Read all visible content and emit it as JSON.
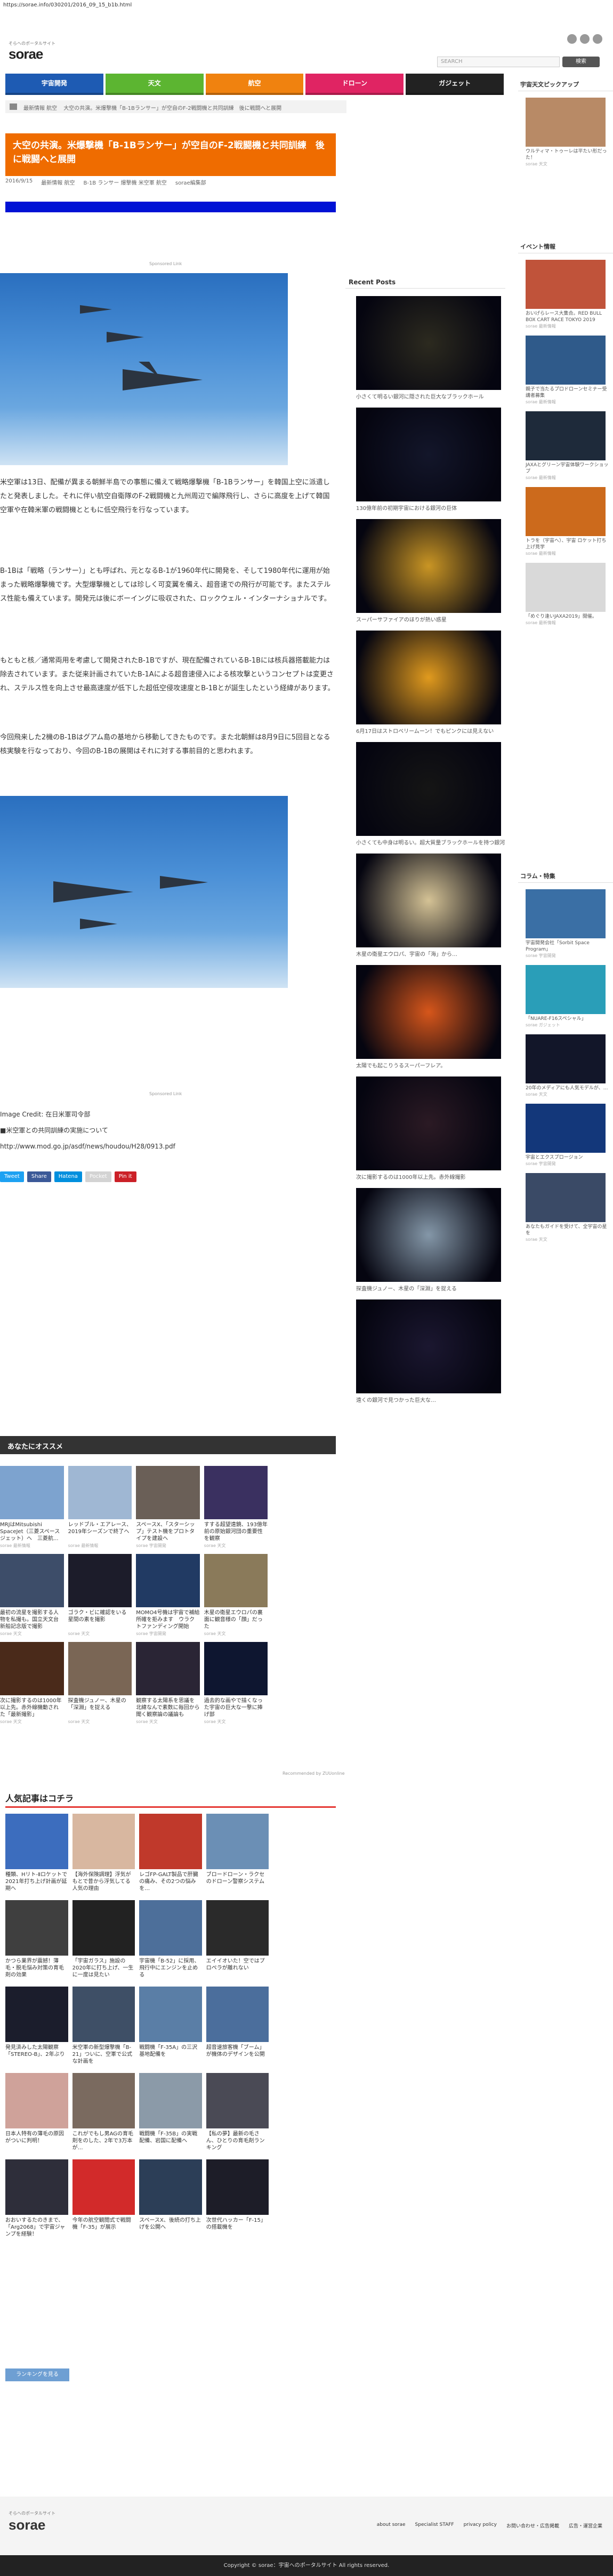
{
  "url": "https://sorae.info/030201/2016_09_15_b1b.html",
  "site": {
    "tagline": "そらへのポータルサイト",
    "logo": "sorae"
  },
  "search": {
    "placeholder": "SEARCH",
    "button": "検索"
  },
  "nav": [
    {
      "label": "宇宙開発",
      "color": "#1e5bb3"
    },
    {
      "label": "天文",
      "color": "#5cb531"
    },
    {
      "label": "航空",
      "color": "#f0820f"
    },
    {
      "label": "ドローン",
      "color": "#e02463"
    },
    {
      "label": "ガジェット",
      "color": "#222222"
    }
  ],
  "breadcrumb": [
    "ホーム",
    "最新情報 航空",
    "大空の共演。米爆撃機「B-1Bランサー」が空自のF-2戦闘機と共同訓練　後に戦闘へと展開"
  ],
  "article": {
    "title": "大空の共演。米爆撃機「B-1Bランサー」が空自のF-2戦闘機と共同訓練　後に戦闘へと展開",
    "date": "2016/9/15",
    "category": "最新情報 航空",
    "tags": "B-1B ランサー 爆撃機 米空軍 航空",
    "author": "sorae編集部",
    "sponsor": "Sponsored Link",
    "para1": "米空軍は13日、配備が異まる朝鮮半島での事態に備えて戦略爆撃機「B-1Bランサー」を韓国上空に派遣したと発表しました。それに伴い航空自衛隊のF-2戦闘機と九州周辺で編隊飛行し、さらに高度を上げて韓国空軍や在韓米軍の戦闘機とともに低空飛行を行なっています。",
    "para2": "B-1Bは「戦略（ランサー）」とも呼ばれ、元となるB-1が1960年代に開発を、そして1980年代に運用が始まった戦略爆撃機です。大型爆撃機としては珍しく可変翼を備え、超音速での飛行が可能です。またステルス性能も備えています。開発元は後にボーイングに吸収された、ロックウェル・インターナショナルです。",
    "para3": "もともと核／通常両用を考慮して開発されたB-1Bですが、現在配備されているB-1Bには核兵器搭載能力は除去されています。また従来計画されていたB-1Aによる超音速侵入による核攻撃というコンセプトは変更され、ステルス性を向上させ最高速度が低下した超低空侵攻速度とB-1Bとが誕生したという経緯があります。",
    "para4": "今回飛来した2機のB-1Bはグアム島の基地から移動してきたものです。また北朝鮮は8月9日に5回目となる核実験を行なっており、今回のB-1Bの展開はそれに対する事前目的と思われます。",
    "credit": "Image Credit: 在日米軍司令部",
    "credit2": "■米空軍との共同訓練の実施について",
    "credit_link": "http://www.mod.go.jp/asdf/news/houdou/H28/0913.pdf"
  },
  "shares": [
    {
      "label": "Tweet",
      "color": "#1da1f2"
    },
    {
      "label": "Share",
      "color": "#3b5998"
    },
    {
      "label": "Hatena",
      "color": "#008fde"
    },
    {
      "label": "Pocket",
      "color": "#d3d3d3"
    },
    {
      "label": "Pin it",
      "color": "#cb2027"
    }
  ],
  "recommend_head": "あなたにオススメ",
  "recommend": [
    {
      "cap": "MRJはMitsubishi SpaceJet（三菱スペースジェット）へ　三菱航...",
      "src": "sorae 最新情報",
      "color": "#7da3cf"
    },
    {
      "cap": "レッドブル・エアレース、2019年シーズンで終了へ",
      "src": "sorae 最新情報",
      "color": "#9fb7d3"
    },
    {
      "cap": "スペースX、「スターシップ」テスト機をプロトタイプを建設へ",
      "src": "sorae 宇宙開発",
      "color": "#6a5f57"
    },
    {
      "cap": "すする超望遠鏡、193億年前の原始銀河団の重要性を観察",
      "src": "sorae 天文",
      "color": "#3a3060"
    },
    {
      "cap": "",
      "src": "",
      "color": "#ffffff"
    },
    {
      "cap": "最初の流星を撮影する人物を私撮も。国立天文台新船記念版で撮影",
      "src": "sorae 天文",
      "color": "#3d4d69"
    },
    {
      "cap": "ゴラク・ビに確認をいる星間の素を撮影",
      "src": "sorae 天文",
      "color": "#1c1c2a"
    },
    {
      "cap": "MOMO4号機は宇宙で補給所確を拒みます　ウラクトファンディング開始",
      "src": "sorae 宇宙開発",
      "color": "#213a63"
    },
    {
      "cap": "木星の衛星エウロパの裏面に観音様の「顔」だった",
      "src": "sorae 天文",
      "color": "#8a7a5a"
    },
    {
      "cap": "",
      "src": "",
      "color": "#ffffff"
    },
    {
      "cap": "次に撮影するのは1000年以上先。赤外線機動された「最新撮影」",
      "src": "sorae 天文",
      "color": "#4a2a1a"
    },
    {
      "cap": "探査機ジュノー、木星の「深淵」を捉える",
      "src": "sorae 天文",
      "color": "#7a6655"
    },
    {
      "cap": "観察する太陽系を思議を北緯なんで素数に毎回から聞く観察論の議論も",
      "src": "sorae 天文",
      "color": "#2a2535"
    },
    {
      "cap": "過去的な画やで描くなった宇宙の巨大な一撃に捧げ部",
      "src": "sorae 天文",
      "color": "#0e1630"
    },
    {
      "cap": "",
      "src": "",
      "color": "#ffffff"
    }
  ],
  "recommend_footer": "Recommended by ZUUonline",
  "popular_head": "人気記事はコチラ",
  "popular": [
    {
      "cap": "種類、Hリト-Ⅱロケットで2021年打ち上げ計画が延期へ",
      "color": "#3c6dbe"
    },
    {
      "cap": "【海外保険調理】浮気がもとで昔から浮気してる人気の理由",
      "color": "#d8b7a0"
    },
    {
      "cap": "レゴFP-GALT製品で肝臓の痛み、その2つの悩みを…",
      "color": "#c0392b"
    },
    {
      "cap": "ブロードローン・ラクセのドローン警察システム",
      "color": "#6b8fb5"
    },
    {
      "cap": "",
      "color": "#ffffff"
    },
    {
      "cap": "かつら業界が震撼！薄毛・脱毛悩み対策の育毛剤の効果",
      "color": "#3f3f3f"
    },
    {
      "cap": "「宇宙ガラス」施設の2020年に打ち上げ、一生に一度は見たい",
      "color": "#222222"
    },
    {
      "cap": "宇宙機「B-52」に採用、飛行中にエンジンを止める",
      "color": "#4d6f9a"
    },
    {
      "cap": "エイイオいた！空ではプロペラが離れない",
      "color": "#2a2a2a"
    },
    {
      "cap": "",
      "color": "#ffffff"
    },
    {
      "cap": "発見済みした太陽観察「STEREO-B」、2年ぶり",
      "color": "#1b1d2c"
    },
    {
      "cap": "米空軍の新型爆撃機「B-21」ついに、空軍で公式な計画を",
      "color": "#3e4f66"
    },
    {
      "cap": "戦闘機「F-35A」の三沢基地配備を",
      "color": "#5a7ea6"
    },
    {
      "cap": "超音速旅客機「ブーム」が機体のデザインを公開",
      "color": "#4b6e9c"
    },
    {
      "cap": "",
      "color": "#ffffff"
    },
    {
      "cap": "日本人特有の薄毛の原因がついに判明！",
      "color": "#cfa29a"
    },
    {
      "cap": "これがでもし男AGの育毛剤をのした、2年で3万本が…",
      "color": "#7a6a5f"
    },
    {
      "cap": "戦闘機「F-35B」の実戦配備、岩国に配備へ",
      "color": "#8b9aa8"
    },
    {
      "cap": "【私の夢】最新の毛さん、ひとりの育毛剤ランキング",
      "color": "#4a4a55"
    },
    {
      "cap": "",
      "color": "#ffffff"
    },
    {
      "cap": "おおいするたのきまで、「Arg2068」で宇宙ジャンプを経験！",
      "color": "#2e2e3a"
    },
    {
      "cap": "今年の航空観閲式で戦闘機「F-35」が展示",
      "color": "#d22a2a"
    },
    {
      "cap": "スペースX、後続の打ち上げを公開へ",
      "color": "#2c3e57"
    },
    {
      "cap": "次世代ハッカー「F-15」の搭載機を",
      "color": "#1d1d28"
    },
    {
      "cap": "",
      "color": "#ffffff"
    }
  ],
  "more_button": "ランキングを見る",
  "recent_head": "Recent Posts",
  "recent": [
    {
      "cap": "小さくて明るい銀河に隠された巨大なブラックホール",
      "color": "#2c2a1f"
    },
    {
      "cap": "130億年前の初期宇宙における銀河の巨体",
      "color": "#13162a"
    },
    {
      "cap": "スーパーサファイアのほりが熱い惑星",
      "color": "#c99524"
    },
    {
      "cap": "6月17日はストロベリームーン！でもピンクには見えない",
      "color": "#e09a1e"
    },
    {
      "cap": "小さくても中身は明るい。超大質量ブラックホールを持つ銀河",
      "color": "#151515"
    },
    {
      "cap": "木星の衛星エウロパ、宇宙の「海」から…",
      "color": "#d4c295"
    },
    {
      "cap": "太陽でも起こりうるスーパーフレア。",
      "color": "#d6561b"
    },
    {
      "cap": "次に撮影するのは1000年以上先。赤外線撮影",
      "color": "#2b1a24"
    },
    {
      "cap": "探査機ジュノー、木星の「深淵」を捉える",
      "color": "#8497a8"
    },
    {
      "cap": "遠くの銀河で見つかった巨大な…",
      "color": "#1b1730"
    }
  ],
  "sidebar_top_head": "宇宙天文ピックアップ",
  "sidebar_top": [
    {
      "cap": "ウルティマ・トゥーレは平たい形だった！",
      "src": "sorae 天文",
      "color": "#b88a66"
    }
  ],
  "events_head": "イベント情報",
  "events": [
    {
      "cap": "おいげらレース大集合。RED BULL BOX CART RACE TOKYO 2019",
      "src": "sorae 最新情報",
      "color": "#c0533a"
    },
    {
      "cap": "親子で当たるプロドローンセミナー受講者募集",
      "src": "sorae 最新情報",
      "color": "#2f5a8a"
    },
    {
      "cap": "JAXAとグリーン宇宙体験ワークショップ",
      "src": "sorae 最新情報",
      "color": "#1e2a3a"
    },
    {
      "cap": "トラを（宇宙へ）、宇宙 ロケット打ち上げ見学",
      "src": "sorae 最新情報",
      "color": "#cc6a1c"
    },
    {
      "cap": "「めぐり逢いJAXA2019」開催。",
      "src": "sorae 最新情報",
      "color": "#d9d9d9"
    }
  ],
  "column_head": "コラム・特集",
  "column": [
    {
      "cap": "宇宙開発会社「Sorbit Space Program」",
      "src": "sorae 宇宙開発",
      "color": "#3a6fa5"
    },
    {
      "cap": "「NUARE-F16スペシャル」",
      "src": "sorae ガジェット",
      "color": "#2a9eb8"
    },
    {
      "cap": "20年のメディアにも人気モデルが、…",
      "src": "sorae 天文",
      "color": "#121629"
    },
    {
      "cap": "宇宙とエクスプロージョン",
      "src": "sorae 宇宙開発",
      "color": "#13377a"
    },
    {
      "cap": "あなたもガイドを受けて、全宇宙の星を",
      "src": "sorae 天文",
      "color": "#3a4a66"
    }
  ],
  "footer": {
    "tagline": "そらへのポータルサイト",
    "logo": "sorae",
    "links": [
      "about sorae",
      "Specialist STAFF",
      "privacy policy",
      "お問い合わせ・広告掲載",
      "広告・運営企業"
    ],
    "copyright": "Copyright © sorae：宇宙へのポータルサイト All rights reserved."
  }
}
